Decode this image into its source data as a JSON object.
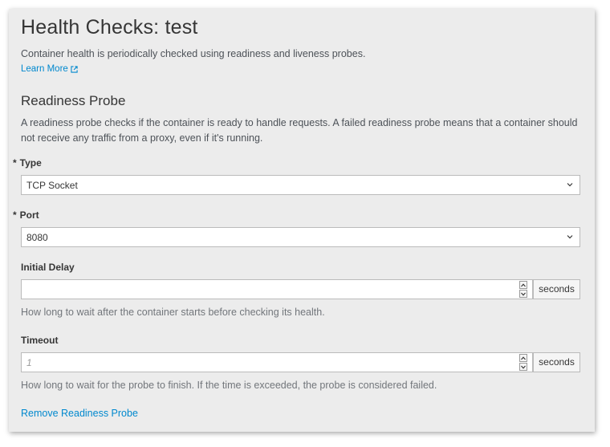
{
  "header": {
    "title": "Health Checks: test",
    "intro": "Container health is periodically checked using readiness and liveness probes.",
    "learn_more": "Learn More"
  },
  "readiness": {
    "section_title": "Readiness Probe",
    "description": "A readiness probe checks if the container is ready to handle requests. A failed readiness probe means that a container should not receive any traffic from a proxy, even if it's running.",
    "type": {
      "required_mark": "*",
      "label": "Type",
      "value": "TCP Socket"
    },
    "port": {
      "required_mark": "*",
      "label": "Port",
      "value": "8080"
    },
    "initial_delay": {
      "label": "Initial Delay",
      "value": "",
      "placeholder": "",
      "unit": "seconds",
      "help": "How long to wait after the container starts before checking its health."
    },
    "timeout": {
      "label": "Timeout",
      "value": "",
      "placeholder": "1",
      "unit": "seconds",
      "help": "How long to wait for the probe to finish. If the time is exceeded, the probe is considered failed."
    },
    "remove_link": "Remove Readiness Probe"
  },
  "colors": {
    "link": "#0088ce",
    "panel_bg": "#ececec",
    "text": "#363636"
  }
}
